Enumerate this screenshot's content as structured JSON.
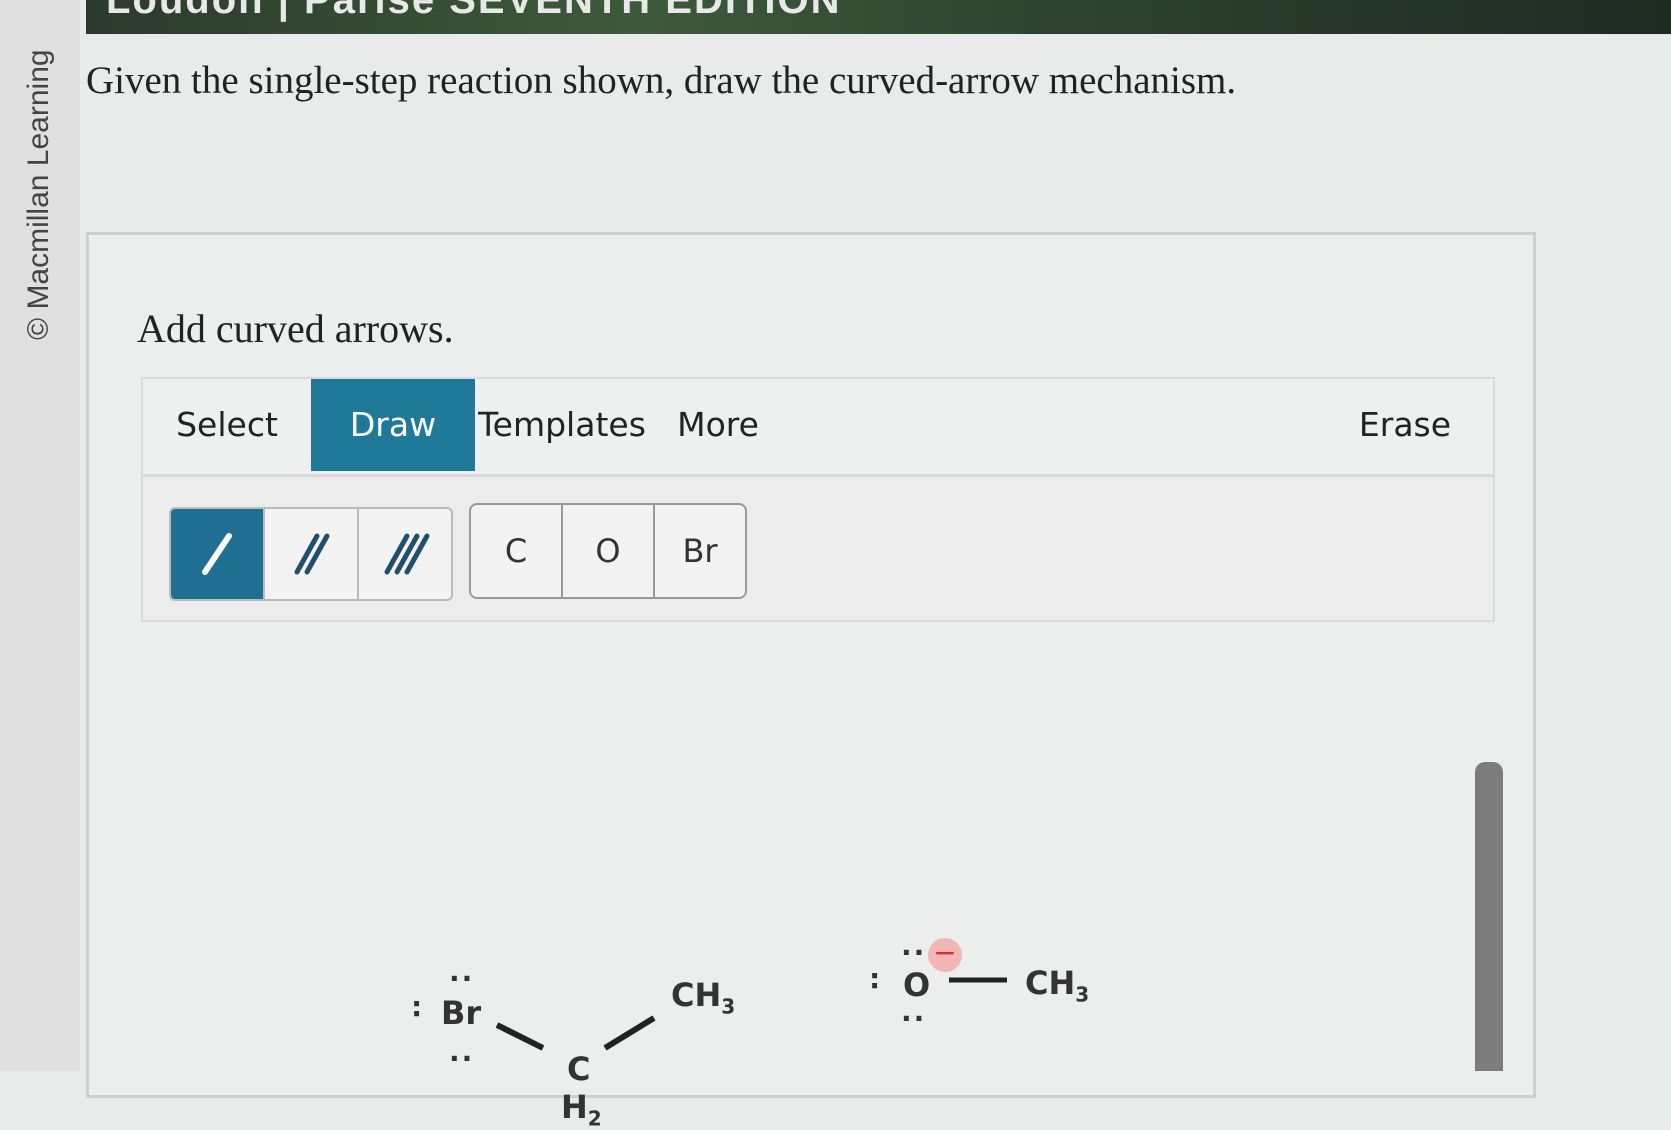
{
  "side_credit": "© Macmillan Learning",
  "banner_text": "Loudon | Parise SEVENTH EDITION",
  "question": "Given the single-step reaction shown, draw the curved-arrow mechanism.",
  "panel": {
    "title": "Add curved arrows.",
    "tabs": {
      "select": "Select",
      "draw": "Draw",
      "templates": "Templates",
      "more": "More",
      "erase": "Erase"
    },
    "atoms": [
      "C",
      "O",
      "Br"
    ]
  },
  "molecules": {
    "bromoethane": {
      "br": "Br",
      "c": "C",
      "h2": "H",
      "h2_sub": "2",
      "ch3": "CH",
      "ch3_sub": "3"
    },
    "methoxide": {
      "o": "O",
      "charge": "−",
      "ch3": "CH",
      "ch3_sub": "3"
    }
  }
}
